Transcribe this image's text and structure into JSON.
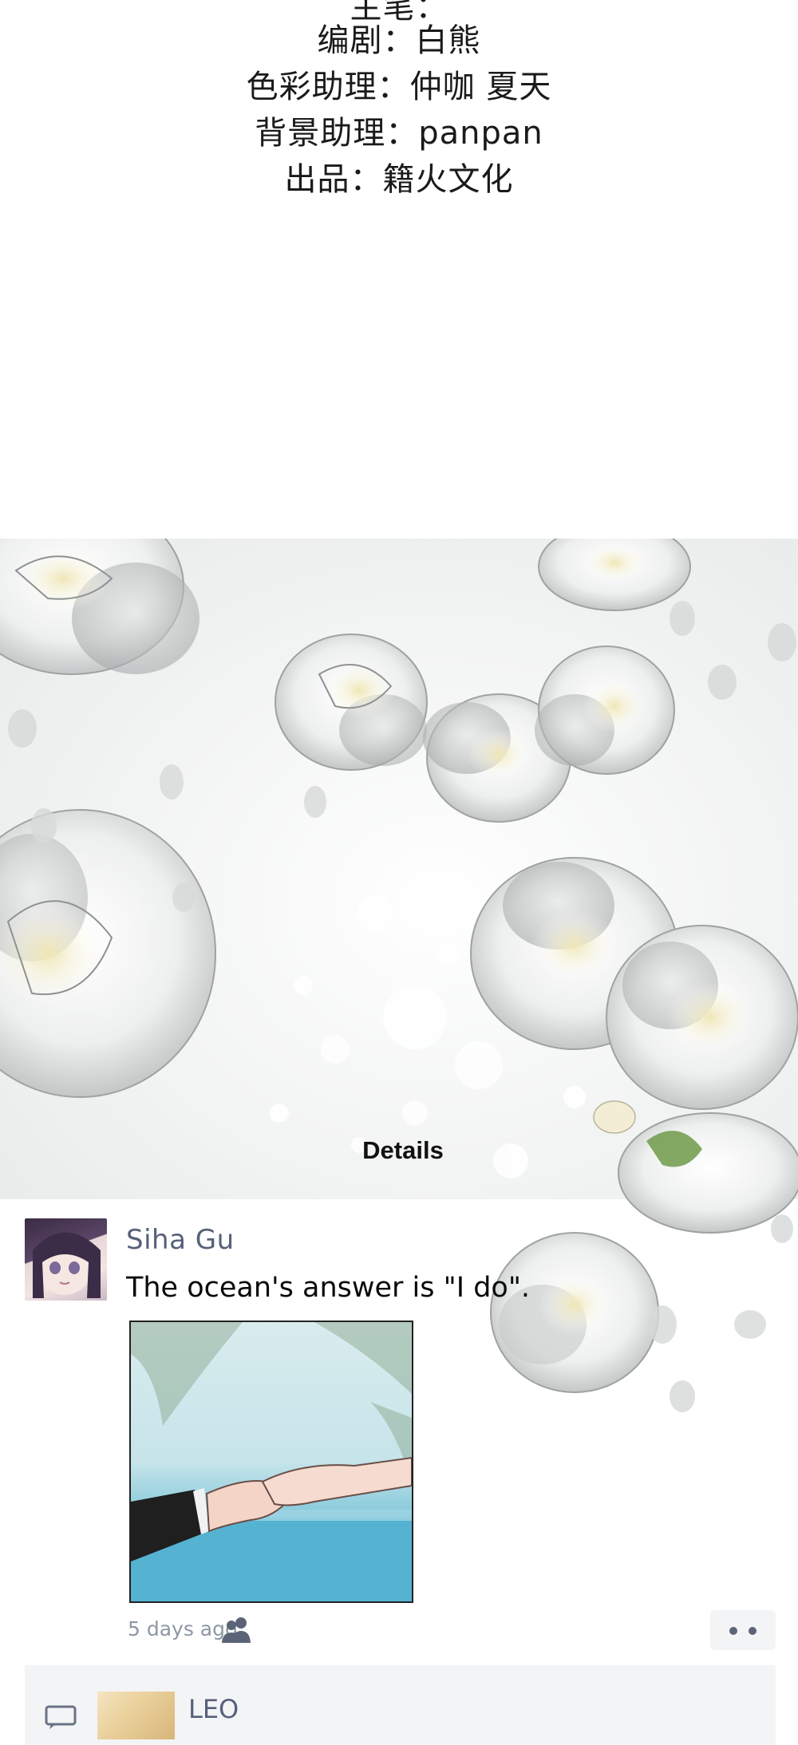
{
  "credits": {
    "cut_line": "主笔：",
    "lines": [
      "编剧：白熊",
      "色彩助理：仲咖 夏天",
      "背景助理：panpan",
      "出品：籍火文化"
    ]
  },
  "banner": {
    "details_label": "Details"
  },
  "post": {
    "author": "Siha Gu",
    "text": "The ocean's answer is \"I do\".",
    "timestamp": "5 days ago",
    "visibility_icon": "people-icon",
    "more_icon": "more-dots-icon"
  },
  "comments": [
    {
      "author": "LEO",
      "icon": "comment-icon"
    }
  ],
  "colors": {
    "name_color": "#56607a",
    "timestamp_color": "#8d97a6",
    "panel_bg": "#f3f4f6"
  }
}
